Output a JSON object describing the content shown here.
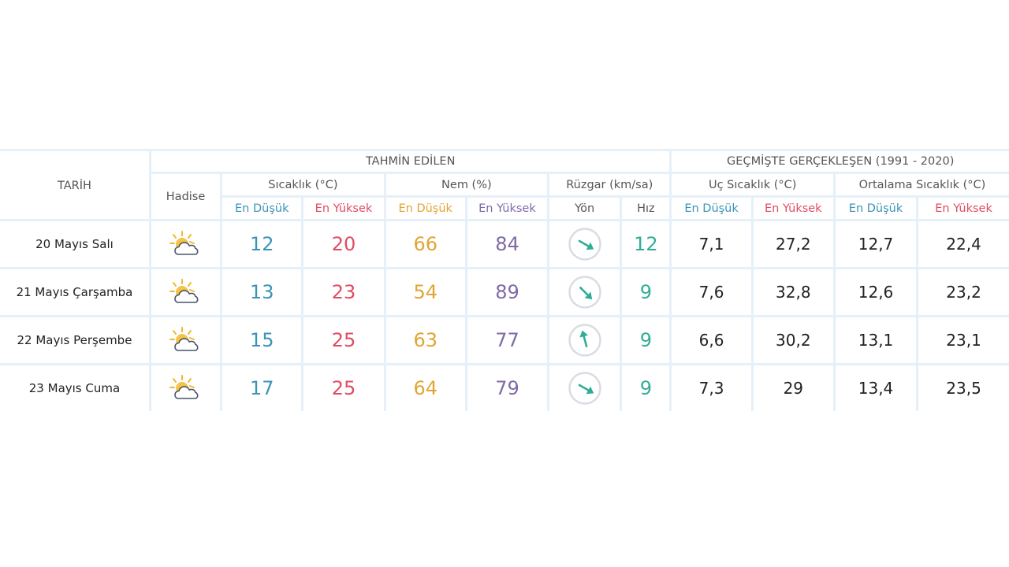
{
  "colors": {
    "low": "#3b93b7",
    "high": "#e04c63",
    "hum_low": "#e1a534",
    "hum_high": "#7f6aa8",
    "wind_speed": "#2fae96",
    "wind_arrow": "#2fae96",
    "border": "#e6f0f8",
    "text": "#222222",
    "header_text": "#555555"
  },
  "header": {
    "tarih": "TARİH",
    "tahmin": "TAHMİN EDİLEN",
    "gecmis": "GEÇMİŞTE GERÇEKLEŞEN (1991 - 2020)",
    "hadise": "Hadise",
    "sicaklik": "Sıcaklık (°C)",
    "nem": "Nem (%)",
    "ruzgar": "Rüzgar (km/sa)",
    "uc": "Uç Sıcaklık (°C)",
    "ortalama": "Ortalama Sıcaklık (°C)",
    "en_dusuk": "En Düşük",
    "en_yuksek": "En Yüksek",
    "yon": "Yön",
    "hiz": "Hız"
  },
  "rows": [
    {
      "date": "20 Mayıs Salı",
      "icon": "partly-cloudy-icon",
      "temp_low": "12",
      "temp_high": "20",
      "hum_low": "66",
      "hum_high": "84",
      "wind_dir_deg": 120,
      "wind_speed": "12",
      "uc_low": "7,1",
      "uc_high": "27,2",
      "ort_low": "12,7",
      "ort_high": "22,4"
    },
    {
      "date": "21 Mayıs Çarşamba",
      "icon": "partly-cloudy-icon",
      "temp_low": "13",
      "temp_high": "23",
      "hum_low": "54",
      "hum_high": "89",
      "wind_dir_deg": 135,
      "wind_speed": "9",
      "uc_low": "7,6",
      "uc_high": "32,8",
      "ort_low": "12,6",
      "ort_high": "23,2"
    },
    {
      "date": "22 Mayıs Perşembe",
      "icon": "partly-cloudy-icon",
      "temp_low": "15",
      "temp_high": "25",
      "hum_low": "63",
      "hum_high": "77",
      "wind_dir_deg": 345,
      "wind_speed": "9",
      "uc_low": "6,6",
      "uc_high": "30,2",
      "ort_low": "13,1",
      "ort_high": "23,1"
    },
    {
      "date": "23 Mayıs Cuma",
      "icon": "partly-cloudy-icon",
      "temp_low": "17",
      "temp_high": "25",
      "hum_low": "64",
      "hum_high": "79",
      "wind_dir_deg": 120,
      "wind_speed": "9",
      "uc_low": "7,3",
      "uc_high": "29",
      "ort_low": "13,4",
      "ort_high": "23,5"
    }
  ]
}
